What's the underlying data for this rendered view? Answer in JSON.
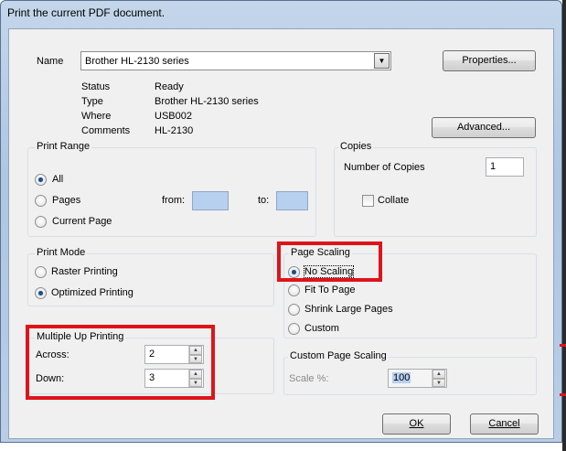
{
  "window": {
    "title": "Print the current PDF document."
  },
  "printer": {
    "name_label": "Name",
    "name_value": "Brother HL-2130 series",
    "properties_button": "Properties...",
    "advanced_button": "Advanced...",
    "info": [
      {
        "label": "Status",
        "value": "Ready"
      },
      {
        "label": "Type",
        "value": "Brother HL-2130 series"
      },
      {
        "label": "Where",
        "value": "USB002"
      },
      {
        "label": "Comments",
        "value": "HL-2130"
      }
    ]
  },
  "print_range": {
    "title": "Print Range",
    "options": [
      {
        "label": "All",
        "checked": true
      },
      {
        "label": "Pages",
        "checked": false
      },
      {
        "label": "Current Page",
        "checked": false
      }
    ],
    "from_label": "from:",
    "to_label": "to:"
  },
  "copies": {
    "title": "Copies",
    "number_label": "Number of Copies",
    "number_value": "1",
    "collate_label": "Collate",
    "collate_checked": false
  },
  "print_mode": {
    "title": "Print Mode",
    "options": [
      {
        "label": "Raster Printing",
        "checked": false
      },
      {
        "label": "Optimized Printing",
        "checked": true
      }
    ]
  },
  "page_scaling": {
    "title": "Page Scaling",
    "options": [
      {
        "label": "No Scaling",
        "checked": true
      },
      {
        "label": "Fit To Page",
        "checked": false
      },
      {
        "label": "Shrink Large Pages",
        "checked": false
      },
      {
        "label": "Custom",
        "checked": false
      }
    ]
  },
  "multiple_up": {
    "title": "Multiple Up Printing",
    "across_label": "Across:",
    "across_value": "2",
    "down_label": "Down:",
    "down_value": "3"
  },
  "custom_scaling": {
    "title": "Custom Page Scaling",
    "scale_label": "Scale %:",
    "scale_value": "100"
  },
  "buttons": {
    "ok": "OK",
    "cancel": "Cancel"
  },
  "colors": {
    "highlight": "#e0131a",
    "radio_dot": "#1b4f8a",
    "window_frame": "#aec6e2"
  }
}
